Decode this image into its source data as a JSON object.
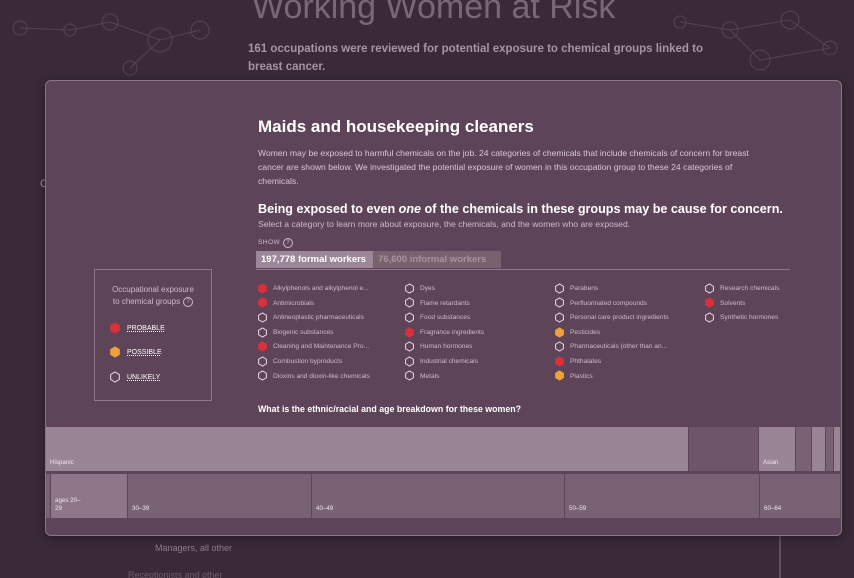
{
  "page": {
    "title": "Working Women at Risk",
    "subtitle": "161 occupations were reviewed for potential exposure to chemical groups linked to breast cancer.",
    "bottom_labels": [
      "Managers, all other",
      "Receptionists and other"
    ],
    "left_letter": "C"
  },
  "modal": {
    "occupation": "Maids and housekeeping cleaners",
    "description": "Women may be exposed to harmful chemicals on the job. 24 categories of chemicals that include chemicals of concern for breast cancer are shown below. We investigated the potential exposure of women in this occupation group to these 24 categories of chemicals.",
    "heading_before": "Being exposed to even ",
    "heading_em": "one",
    "heading_after": " of the chemicals in these groups may be cause for concern.",
    "select_text": "Select a category to learn more about exposure, the chemicals, and the women who are exposed.",
    "show_label": "SHOW",
    "show_help": "?",
    "tabs": [
      {
        "label": "197,778 formal workers",
        "active": true
      },
      {
        "label": "76,600 informal workers",
        "active": false
      }
    ],
    "legend": {
      "title_line1": "Occupational exposure",
      "title_line2": "to chemical groups",
      "help": "?",
      "items": [
        {
          "label": "PROBABLE",
          "level": "probable"
        },
        {
          "label": "POSSIBLE",
          "level": "possible"
        },
        {
          "label": "UNLIKELY",
          "level": "unlikely"
        }
      ]
    },
    "chemical_columns": [
      [
        {
          "label": "Alkylphenols and alkylphenol e...",
          "level": "probable"
        },
        {
          "label": "Antimicrobials",
          "level": "probable"
        },
        {
          "label": "Antineoplastic pharmaceuticals",
          "level": "unlikely"
        },
        {
          "label": "Biogenic substances",
          "level": "unlikely"
        },
        {
          "label": "Cleaning and Maintenance Pro...",
          "level": "probable"
        },
        {
          "label": "Combustion byproducts",
          "level": "unlikely"
        },
        {
          "label": "Dioxins and dioxin-like chemicals",
          "level": "unlikely"
        }
      ],
      [
        {
          "label": "Dyes",
          "level": "unlikely"
        },
        {
          "label": "Flame retardants",
          "level": "unlikely"
        },
        {
          "label": "Food substances",
          "level": "unlikely"
        },
        {
          "label": "Fragrance ingredients",
          "level": "probable"
        },
        {
          "label": "Human hormones",
          "level": "unlikely"
        },
        {
          "label": "Industrial chemicals",
          "level": "unlikely"
        },
        {
          "label": "Metals",
          "level": "unlikely"
        }
      ],
      [
        {
          "label": "Parabens",
          "level": "unlikely"
        },
        {
          "label": "Perfluorinated compounds",
          "level": "unlikely"
        },
        {
          "label": "Personal care product ingredients",
          "level": "unlikely"
        },
        {
          "label": "Pesticides",
          "level": "possible"
        },
        {
          "label": "Pharmaceuticals (other than an...",
          "level": "unlikely"
        },
        {
          "label": "Phthalates",
          "level": "probable"
        },
        {
          "label": "Plastics",
          "level": "possible"
        }
      ],
      [
        {
          "label": "Research chemicals",
          "level": "unlikely"
        },
        {
          "label": "Solvents",
          "level": "probable"
        },
        {
          "label": "Synthetic hormones",
          "level": "unlikely"
        }
      ]
    ],
    "question": "What is the ethnic/racial and age breakdown for these women?",
    "ethnicity_labels": [
      "Hispanic",
      "Asian"
    ],
    "age_labels": [
      "ages 20–29",
      "30–39",
      "40–49",
      "50–59",
      "60–64"
    ]
  },
  "colors": {
    "probable": "#d9313a",
    "possible": "#f0a23a",
    "unlikely": "#5d4459"
  }
}
